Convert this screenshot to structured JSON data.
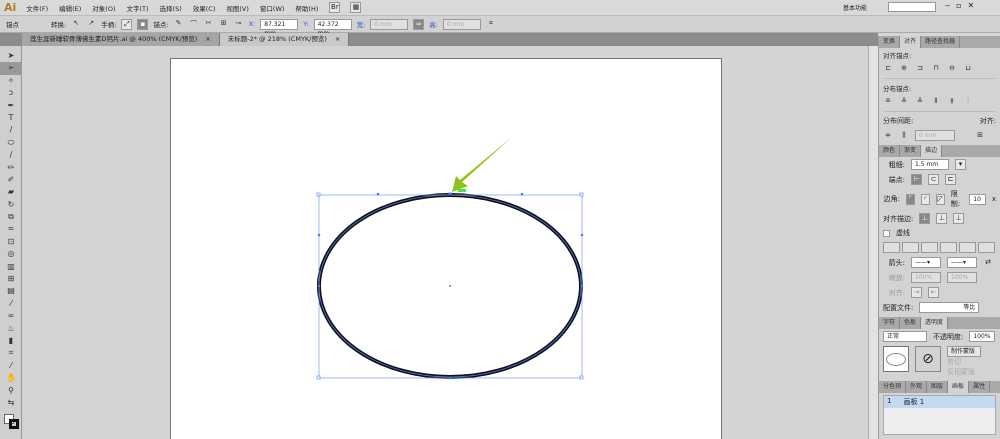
{
  "app": {
    "logo": "Ai"
  },
  "menu": [
    "文件(F)",
    "编辑(E)",
    "对象(O)",
    "文字(T)",
    "选择(S)",
    "效果(C)",
    "视图(V)",
    "窗口(W)",
    "帮助(H)"
  ],
  "workspace": {
    "label": "基本功能",
    "search_placeholder": ""
  },
  "control": {
    "selection": "锚点",
    "convert": "转换:",
    "handles": "手柄:",
    "anchors": "锚点:",
    "x_label": "X:",
    "x": "87.321 mm",
    "y_label": "Y:",
    "y": "42.372 mm",
    "w_label": "宽:",
    "w": "0 mm",
    "h_label": "高:",
    "h": "0 mm"
  },
  "tabs": [
    {
      "label": "莲生涯新睡软骨薄佛生素D钙片.ai @ 400% (CMYK/预览)",
      "active": false
    },
    {
      "label": "未标题-2* @ 218% (CMYK/预览)",
      "active": true
    }
  ],
  "tools": [
    "selection",
    "direct-selection",
    "magic-wand",
    "lasso",
    "pen",
    "type",
    "line",
    "ellipse",
    "paintbrush",
    "pencil",
    "blob-brush",
    "eraser",
    "rotate",
    "scale",
    "warp",
    "free-transform",
    "shape-builder",
    "perspective-grid",
    "mesh",
    "gradient",
    "eyedropper",
    "blend",
    "symbol-sprayer",
    "column-graph",
    "artboard",
    "slice",
    "hand",
    "zoom"
  ],
  "canvas": {
    "arrow_color": "#8dc21f",
    "selection_color": "#4a7cf0",
    "stroke_color": "#111111"
  },
  "align_panel": {
    "tabs": [
      "变换",
      "对齐",
      "路径查找器"
    ],
    "align_objects": "对齐锚点:",
    "distribute_objects": "分布锚点:",
    "distribute_spacing": "分布间距:",
    "align_to": "对齐:",
    "spacing": "0 mm"
  },
  "stroke_panel": {
    "tabs": [
      "颜色",
      "渐变",
      "描边"
    ],
    "weight_label": "粗细:",
    "weight": "1.5 mm",
    "cap_label": "端点:",
    "corner_label": "边角:",
    "limit_label": "限制:",
    "limit": "10",
    "limit_unit": "x",
    "align_label": "对齐描边:",
    "dashed_label": "虚线",
    "arrowheads_label": "箭头:",
    "scale_label": "缩放:",
    "scale1": "100%",
    "scale2": "100%",
    "align2_label": "对齐:",
    "profile_label": "配置文件:",
    "profile": "等比"
  },
  "transparency_panel": {
    "tabs": [
      "字符",
      "色板",
      "透明度"
    ],
    "blend_mode": "正常",
    "opacity_label": "不透明度:",
    "opacity": "100%",
    "make_mask": "制作蒙版",
    "clip": "剪切",
    "invert": "反相蒙版"
  },
  "artboards_panel": {
    "tabs": [
      "分色预",
      "外观",
      "图层",
      "画板",
      "属性"
    ],
    "rows": [
      {
        "index": "1",
        "name": "画板 1"
      }
    ]
  }
}
